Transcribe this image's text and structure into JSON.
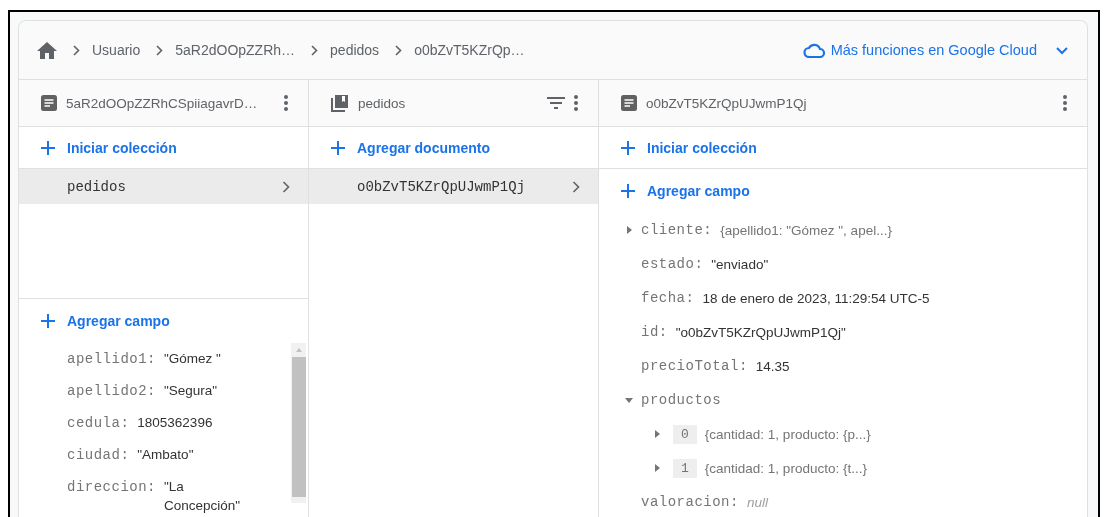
{
  "breadcrumb": [
    {
      "label": "Usuario"
    },
    {
      "label": "5aR2dOOpZZRh…"
    },
    {
      "label": "pedidos"
    },
    {
      "label": "o0bZvT5KZrQp…"
    }
  ],
  "cloud_link": {
    "label": "Más funciones en Google Cloud"
  },
  "panels": [
    {
      "kind": "document",
      "title": "5aR2dOOpZZRhCSpiiagavrD…",
      "actions": [
        "Iniciar colección"
      ],
      "items": [
        {
          "label": "pedidos",
          "selected": true
        }
      ],
      "add_field": "Agregar campo",
      "fields": [
        {
          "kind": "string",
          "key": "apellido1:",
          "value": "\"Gómez \""
        },
        {
          "kind": "string",
          "key": "apellido2:",
          "value": "\"Segura\""
        },
        {
          "kind": "number",
          "key": "cedula:",
          "value": "1805362396"
        },
        {
          "kind": "string",
          "key": "ciudad:",
          "value": "\"Ambato\""
        },
        {
          "kind": "string",
          "key": "direccion:",
          "value": "\"La Concepción\""
        }
      ]
    },
    {
      "kind": "collection",
      "title": "pedidos",
      "actions": [
        "Agregar documento"
      ],
      "items": [
        {
          "label": "o0bZvT5KZrQpUJwmP1Qj",
          "selected": true
        }
      ]
    },
    {
      "kind": "document",
      "title": "o0bZvT5KZrQpUJwmP1Qj",
      "actions": [
        "Iniciar colección"
      ],
      "add_field": "Agregar campo",
      "fields": [
        {
          "kind": "map",
          "key": "cliente:",
          "value": "{apellido1: \"Gómez \", apel...}",
          "expanded": false
        },
        {
          "kind": "string",
          "key": "estado:",
          "value": "\"enviado\""
        },
        {
          "kind": "timestamp",
          "key": "fecha:",
          "value": "18 de enero de 2023, 11:29:54 UTC-5"
        },
        {
          "kind": "string",
          "key": "id:",
          "value": "\"o0bZvT5KZrQpUJwmP1Qj\""
        },
        {
          "kind": "number",
          "key": "precioTotal:",
          "value": "14.35"
        },
        {
          "kind": "array",
          "key": "productos",
          "expanded": true,
          "children": [
            {
              "kind": "map",
              "key": "0",
              "value": "{cantidad: 1, producto: {p...}",
              "expanded": false
            },
            {
              "kind": "map",
              "key": "1",
              "value": "{cantidad: 1, producto: {t...}",
              "expanded": false
            }
          ]
        },
        {
          "kind": "null",
          "key": "valoracion:",
          "value": "null"
        }
      ]
    }
  ]
}
